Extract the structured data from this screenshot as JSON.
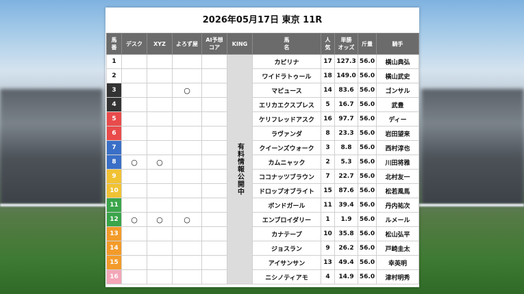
{
  "header": {
    "title": "2026年05月17日 東京 11R"
  },
  "columns": {
    "umaban": "馬\n番",
    "desk": "デスク",
    "xyz": "XYZ",
    "yoroshiku": "よろず屋",
    "ai": "AI予想\nコア",
    "king": "KING",
    "horse": "馬\n名",
    "popularity": "人\n気",
    "odds": "単勝\nオッズ",
    "weight": "斤量",
    "jockey": "騎手"
  },
  "king_text": "有料情報公開中",
  "rows": [
    {
      "num": "1",
      "desk": "",
      "xyz": "",
      "yoro": "",
      "ai": "",
      "horse": "カピリナ",
      "pop": "17",
      "odds": "127.3",
      "kin": "56.0",
      "jockey": "横山典弘"
    },
    {
      "num": "2",
      "desk": "",
      "xyz": "",
      "yoro": "",
      "ai": "",
      "horse": "ワイドラトゥール",
      "pop": "18",
      "odds": "149.0",
      "kin": "56.0",
      "jockey": "横山武史"
    },
    {
      "num": "3",
      "desk": "",
      "xyz": "",
      "yoro": "○",
      "ai": "",
      "horse": "マピュース",
      "pop": "14",
      "odds": "83.6",
      "kin": "56.0",
      "jockey": "ゴンサル"
    },
    {
      "num": "4",
      "desk": "",
      "xyz": "",
      "yoro": "",
      "ai": "",
      "horse": "エリカエクスプレス",
      "pop": "5",
      "odds": "16.7",
      "kin": "56.0",
      "jockey": "武豊"
    },
    {
      "num": "5",
      "desk": "",
      "xyz": "",
      "yoro": "",
      "ai": "",
      "horse": "ケリフレッドアスク",
      "pop": "16",
      "odds": "97.7",
      "kin": "56.0",
      "jockey": "ディー"
    },
    {
      "num": "6",
      "desk": "",
      "xyz": "",
      "yoro": "",
      "ai": "",
      "horse": "ラヴァンダ",
      "pop": "8",
      "odds": "23.3",
      "kin": "56.0",
      "jockey": "岩田望来"
    },
    {
      "num": "7",
      "desk": "",
      "xyz": "",
      "yoro": "",
      "ai": "",
      "horse": "クイーンズウォーク",
      "pop": "3",
      "odds": "8.8",
      "kin": "56.0",
      "jockey": "西村淳也"
    },
    {
      "num": "8",
      "desk": "○",
      "xyz": "○",
      "yoro": "",
      "ai": "",
      "horse": "カムニャック",
      "pop": "2",
      "odds": "5.3",
      "kin": "56.0",
      "jockey": "川田将雅"
    },
    {
      "num": "9",
      "desk": "",
      "xyz": "",
      "yoro": "",
      "ai": "",
      "horse": "ココナッツブラウン",
      "pop": "7",
      "odds": "22.7",
      "kin": "56.0",
      "jockey": "北村友一"
    },
    {
      "num": "10",
      "desk": "",
      "xyz": "",
      "yoro": "",
      "ai": "",
      "horse": "ドロップオブライト",
      "pop": "15",
      "odds": "87.6",
      "kin": "56.0",
      "jockey": "松若風馬"
    },
    {
      "num": "11",
      "desk": "",
      "xyz": "",
      "yoro": "",
      "ai": "",
      "horse": "ボンドガール",
      "pop": "11",
      "odds": "39.4",
      "kin": "56.0",
      "jockey": "丹内祐次"
    },
    {
      "num": "12",
      "desk": "○",
      "xyz": "○",
      "yoro": "○",
      "ai": "",
      "horse": "エンブロイダリー",
      "pop": "1",
      "odds": "1.9",
      "kin": "56.0",
      "jockey": "ルメール"
    },
    {
      "num": "13",
      "desk": "",
      "xyz": "",
      "yoro": "",
      "ai": "",
      "horse": "カナテープ",
      "pop": "10",
      "odds": "35.8",
      "kin": "56.0",
      "jockey": "松山弘平"
    },
    {
      "num": "14",
      "desk": "",
      "xyz": "",
      "yoro": "",
      "ai": "",
      "horse": "ジョスラン",
      "pop": "9",
      "odds": "26.2",
      "kin": "56.0",
      "jockey": "戸崎圭太"
    },
    {
      "num": "15",
      "desk": "",
      "xyz": "",
      "yoro": "",
      "ai": "",
      "horse": "アイサンサン",
      "pop": "13",
      "odds": "49.4",
      "kin": "56.0",
      "jockey": "幸英明"
    },
    {
      "num": "16",
      "desk": "",
      "xyz": "",
      "yoro": "",
      "ai": "",
      "horse": "ニシノティアモ",
      "pop": "4",
      "odds": "14.9",
      "kin": "56.0",
      "jockey": "津村明秀"
    }
  ],
  "frame_colors": {
    "1": "#ffffff",
    "2": "#ffffff",
    "3": "#333333",
    "4": "#333333",
    "5": "#e94b4b",
    "6": "#e94b4b",
    "7": "#3a6fc7",
    "8": "#3a6fc7",
    "9": "#f1c232",
    "10": "#f1c232",
    "11": "#3aa54a",
    "12": "#3aa54a",
    "13": "#f39b2a",
    "14": "#f39b2a",
    "15": "#f39b2a",
    "16": "#f3a6b7"
  }
}
